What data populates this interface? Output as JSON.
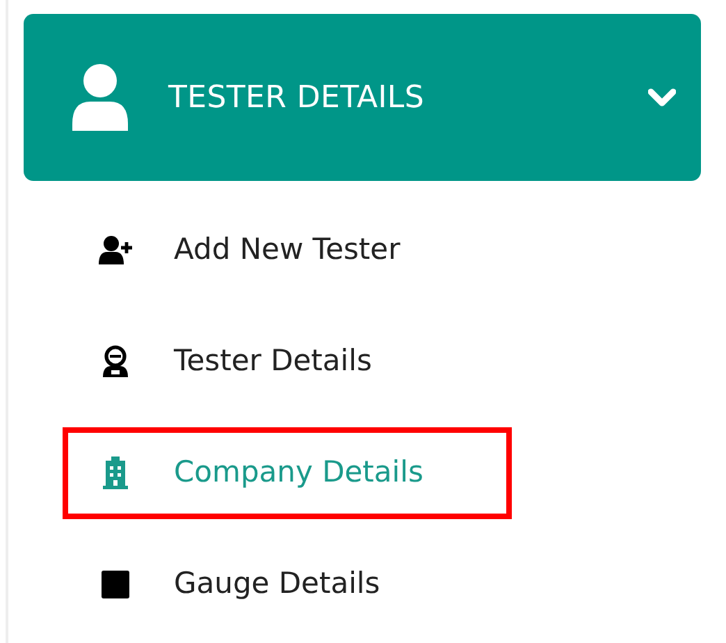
{
  "menu_header": {
    "title": "TESTER DETAILS",
    "expanded": true
  },
  "menu_items": [
    {
      "label": "Add New Tester",
      "selected": false
    },
    {
      "label": "Tester Details",
      "selected": false
    },
    {
      "label": "Company Details",
      "selected": true
    },
    {
      "label": "Gauge Details",
      "selected": false
    }
  ]
}
